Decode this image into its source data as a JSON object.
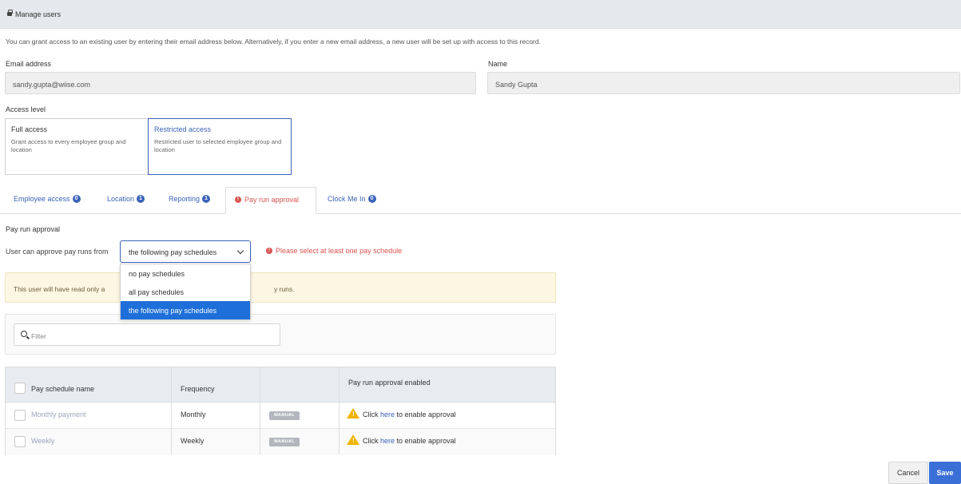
{
  "header": {
    "title": "Manage users",
    "icon": "lock-icon"
  },
  "intro": "You can grant access to an existing user by entering their email address below. Alternatively, if you enter a new email address, a new user will be set up with access to this record.",
  "email": {
    "label": "Email address",
    "value": "sandy.gupta@wiise.com"
  },
  "name": {
    "label": "Name",
    "value": "Sandy Gupta"
  },
  "access_level": {
    "label": "Access level",
    "options": [
      {
        "title": "Full access",
        "desc": "Grant access to every employee group and location"
      },
      {
        "title": "Restricted access",
        "desc": "Restricted user to selected employee group and location"
      }
    ],
    "selected": "Restricted access"
  },
  "tabs": [
    {
      "label": "Employee access",
      "badge": "0"
    },
    {
      "label": "Location",
      "badge": "1"
    },
    {
      "label": "Reporting",
      "badge": "1"
    },
    {
      "label": "Pay run approval",
      "active": true,
      "error": true
    },
    {
      "label": "Clock Me In",
      "badge": "0"
    }
  ],
  "pay_run": {
    "section_title": "Pay run approval",
    "approve_label": "User can approve pay runs from",
    "select_value": "the following pay schedules",
    "error": "Please select at least one pay schedule",
    "dropdown_options": [
      "no pay schedules",
      "all pay schedules",
      "the following pay schedules"
    ],
    "info_left": "This user will have read only a",
    "info_right": "y runs.",
    "filter_placeholder": "Filter"
  },
  "table": {
    "headers": [
      "Pay schedule name",
      "Frequency",
      "",
      "Pay run approval enabled"
    ],
    "rows": [
      {
        "name": "Monthly payment",
        "frequency": "Monthly",
        "tag": "MANUAL",
        "pre": "Click ",
        "link": "here",
        "post": " to enable approval"
      },
      {
        "name": "Weekly",
        "frequency": "Weekly",
        "tag": "MANUAL",
        "pre": "Click ",
        "link": "here",
        "post": " to enable approval"
      }
    ]
  },
  "buttons": {
    "cancel": "Cancel",
    "save": "Save"
  },
  "colors": {
    "accent": "#3b63b8",
    "error": "#d9534f",
    "dropdown_selected": "#1e6fd9",
    "warning": "#f0b400"
  }
}
